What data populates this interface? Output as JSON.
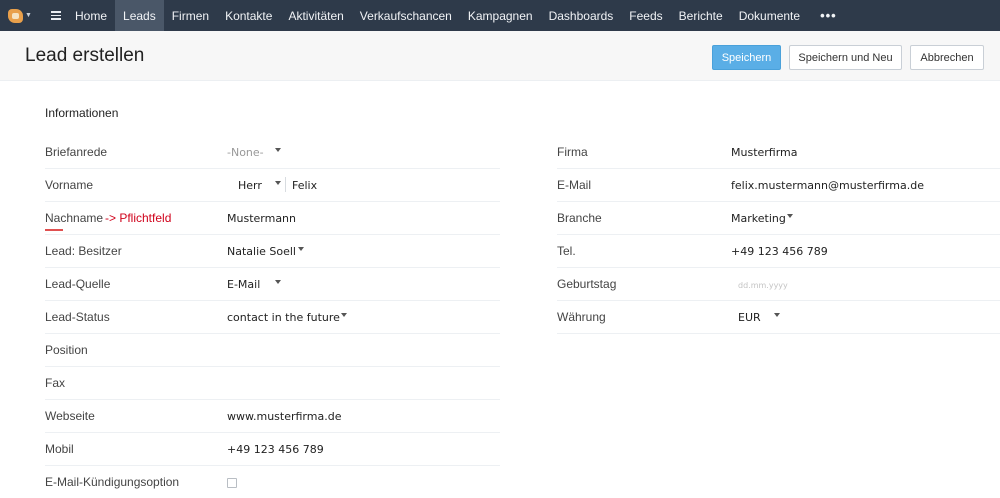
{
  "nav": {
    "items": [
      "Home",
      "Leads",
      "Firmen",
      "Kontakte",
      "Aktivitäten",
      "Verkaufschancen",
      "Kampagnen",
      "Dashboards",
      "Feeds",
      "Berichte",
      "Dokumente"
    ],
    "active": "Leads",
    "more": "•••"
  },
  "header": {
    "title": "Lead erstellen",
    "save_label": "Speichern",
    "save_new_label": "Speichern und Neu",
    "cancel_label": "Abbrechen",
    "accent_color": "#5aaee6"
  },
  "section": {
    "title": "Informationen"
  },
  "left_fields": {
    "salutation": {
      "label": "Briefanrede",
      "value": "-None-"
    },
    "firstname": {
      "label": "Vorname",
      "salutation": "Herr",
      "value": "Felix"
    },
    "lastname": {
      "label": "Nachname",
      "note": "-> Pflichtfeld",
      "value": "Mustermann"
    },
    "owner": {
      "label": "Lead: Besitzer",
      "value": "Natalie Soell"
    },
    "source": {
      "label": "Lead-Quelle",
      "value": "E-Mail"
    },
    "status": {
      "label": "Lead-Status",
      "value": "contact in the future"
    },
    "position": {
      "label": "Position",
      "value": ""
    },
    "fax": {
      "label": "Fax",
      "value": ""
    },
    "website": {
      "label": "Webseite",
      "value": "www.musterfirma.de"
    },
    "mobile": {
      "label": "Mobil",
      "value": "+49 123 456 789"
    },
    "email_optout": {
      "label": "E-Mail-Kündigungsoption",
      "checked": false
    }
  },
  "right_fields": {
    "company": {
      "label": "Firma",
      "value": "Musterfirma"
    },
    "email": {
      "label": "E-Mail",
      "value": "felix.mustermann@musterfirma.de"
    },
    "industry": {
      "label": "Branche",
      "value": "Marketing"
    },
    "phone": {
      "label": "Tel.",
      "value": "+49 123 456 789"
    },
    "birthday": {
      "label": "Geburtstag",
      "placeholder": "dd.mm.yyyy"
    },
    "currency": {
      "label": "Währung",
      "value": "EUR"
    }
  }
}
